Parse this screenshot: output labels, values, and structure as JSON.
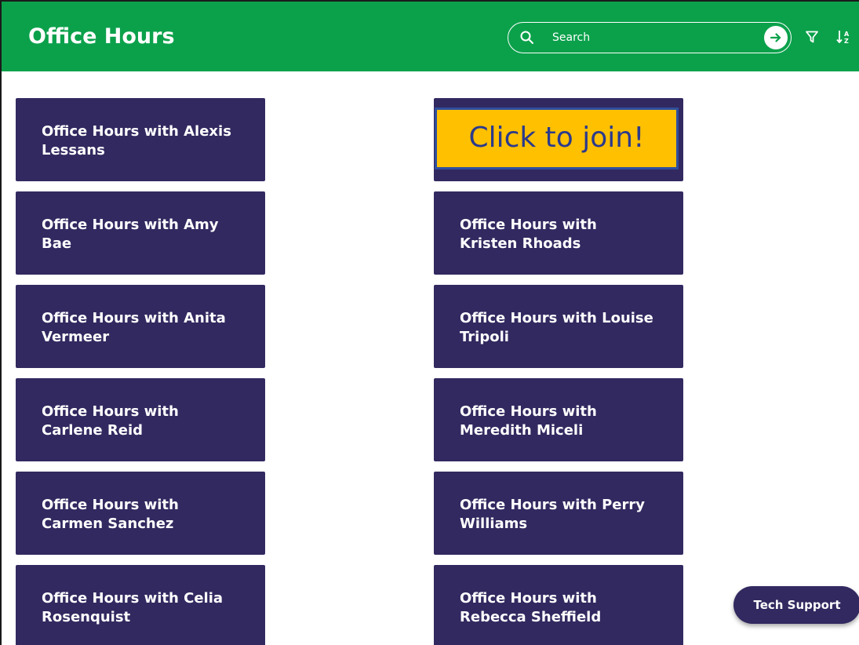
{
  "header": {
    "title": "Office Hours",
    "background_color": "#0ba14b",
    "search": {
      "placeholder": "Search",
      "value": "",
      "icon": "search-icon",
      "submit_icon": "arrow-right-icon"
    },
    "filter_icon": "filter-icon",
    "sort_icon": "sort-az-icon"
  },
  "cards": {
    "left": [
      "Office Hours with Alexis Lessans",
      "Office Hours with Amy Bae",
      "Office Hours with Anita Vermeer",
      "Office Hours with Carlene Reid",
      "Office Hours with Carmen Sanchez",
      "Office Hours with Celia Rosenquist"
    ],
    "right": [
      "Office Hours with Kristen Rhoads",
      "Office Hours with Louise Tripoli",
      "Office Hours with Meredith Miceli",
      "Office Hours with Perry Williams",
      "Office Hours with Rebecca Sheffield"
    ],
    "card_color": "#322960"
  },
  "join_banner": {
    "text": "Click to join!",
    "background_color": "#ffc000",
    "text_color": "#2b3a8c"
  },
  "tech_support": {
    "label": "Tech Support"
  }
}
